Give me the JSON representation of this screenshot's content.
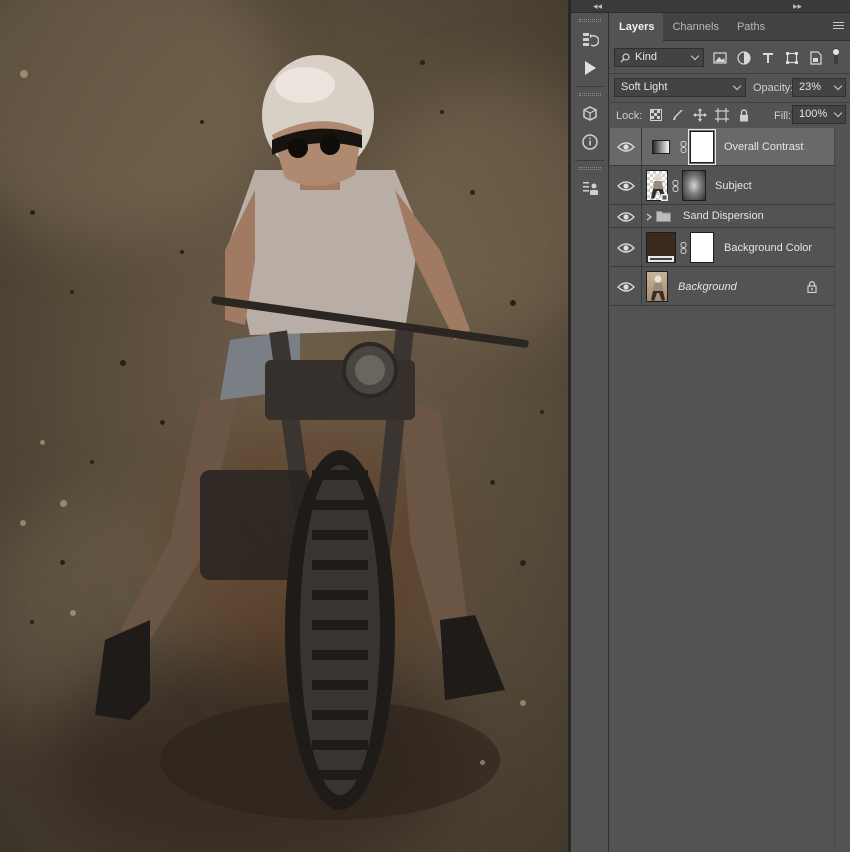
{
  "panel": {
    "tabs": [
      {
        "label": "Layers",
        "active": true
      },
      {
        "label": "Channels",
        "active": false
      },
      {
        "label": "Paths",
        "active": false
      }
    ],
    "filter": {
      "value": "Kind",
      "icons": [
        "image-filter-icon",
        "adjustment-filter-icon",
        "type-filter-icon",
        "shape-filter-icon",
        "smart-object-filter-icon",
        "filter-toggle-icon"
      ]
    },
    "blend_mode": "Soft Light",
    "opacity_label": "Opacity:",
    "opacity_value": "23%",
    "lock_label": "Lock:",
    "fill_label": "Fill:",
    "fill_value": "100%"
  },
  "layers": [
    {
      "name": "Overall Contrast",
      "selected": true,
      "visible": true,
      "type": "gradient-map",
      "has_mask": true
    },
    {
      "name": "Subject",
      "selected": false,
      "visible": true,
      "type": "smart-object",
      "has_mask": true
    },
    {
      "name": "Sand Dispersion",
      "selected": false,
      "visible": true,
      "type": "group"
    },
    {
      "name": "Background Color",
      "selected": false,
      "visible": true,
      "type": "solid-color",
      "fill_color": "#3a2b1e",
      "has_mask": true
    },
    {
      "name": "Background",
      "selected": false,
      "visible": true,
      "type": "background",
      "locked": true,
      "italic": true
    }
  ],
  "colors": {
    "panel_bg": "#535353",
    "selected_layer": "#696969",
    "tab_bar": "#424242"
  }
}
